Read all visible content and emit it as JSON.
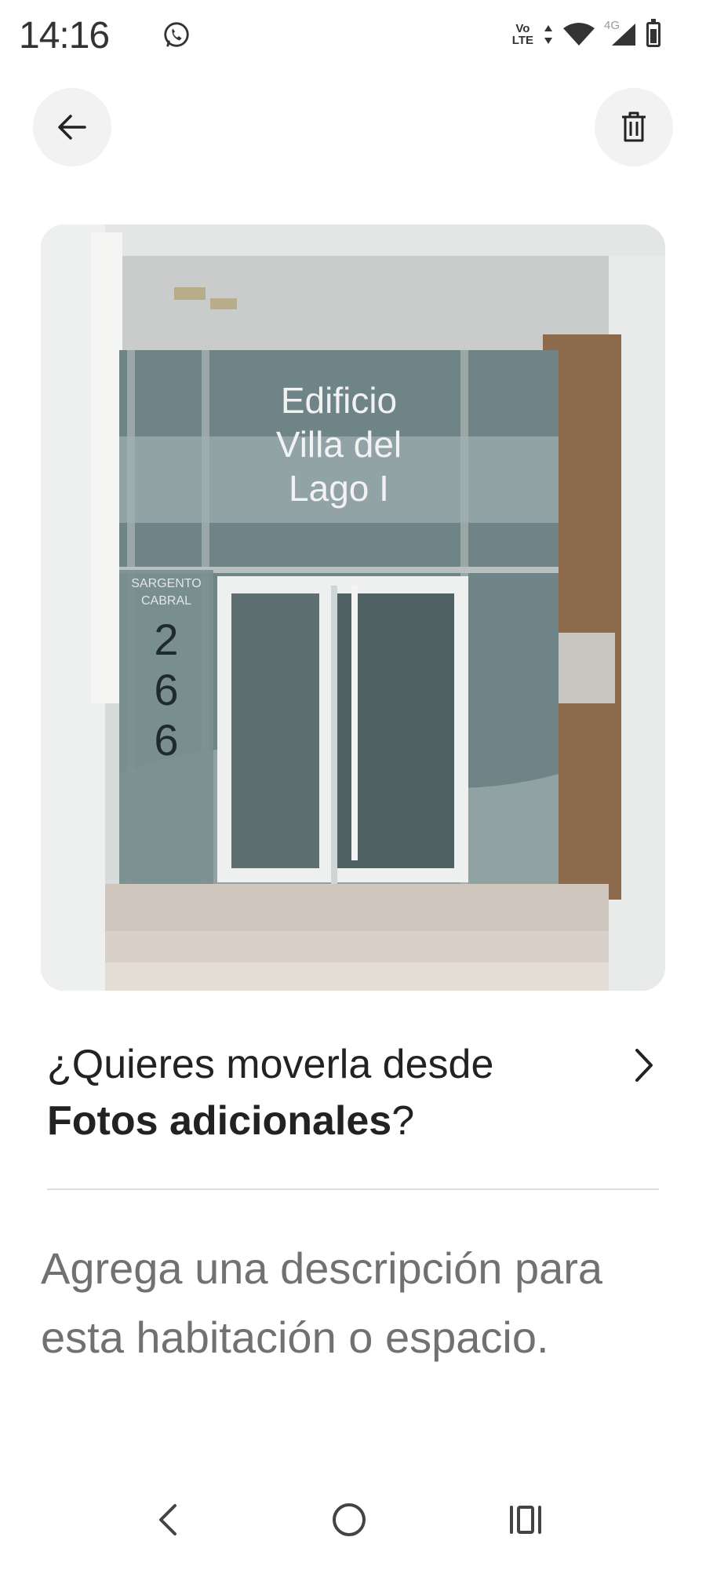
{
  "status_bar": {
    "time": "14:16",
    "volte_top": "Vo",
    "volte_bottom": "LTE",
    "network": "4G",
    "icons": [
      "whatsapp-icon",
      "volte-icon",
      "data-arrows-icon",
      "wifi-icon",
      "cell-signal-icon",
      "battery-icon"
    ]
  },
  "header": {
    "back_icon": "arrow-left-icon",
    "delete_icon": "trash-icon"
  },
  "photo": {
    "sign_line1": "Edificio",
    "sign_line2": "Villa del",
    "sign_line3": "Lago I",
    "street_line1": "SARGENTO",
    "street_line2": "CABRAL",
    "number_digits": [
      "2",
      "6",
      "6"
    ]
  },
  "move_prompt": {
    "text_prefix": "¿Quieres moverla desde ",
    "text_bold": "Fotos adicionales",
    "text_suffix": "?",
    "chevron_icon": "chevron-right-icon"
  },
  "description": {
    "placeholder": "Agrega una descripción para esta habitación o espacio."
  },
  "nav_bar": {
    "items": [
      "back-nav-icon",
      "home-nav-icon",
      "recents-nav-icon"
    ]
  }
}
